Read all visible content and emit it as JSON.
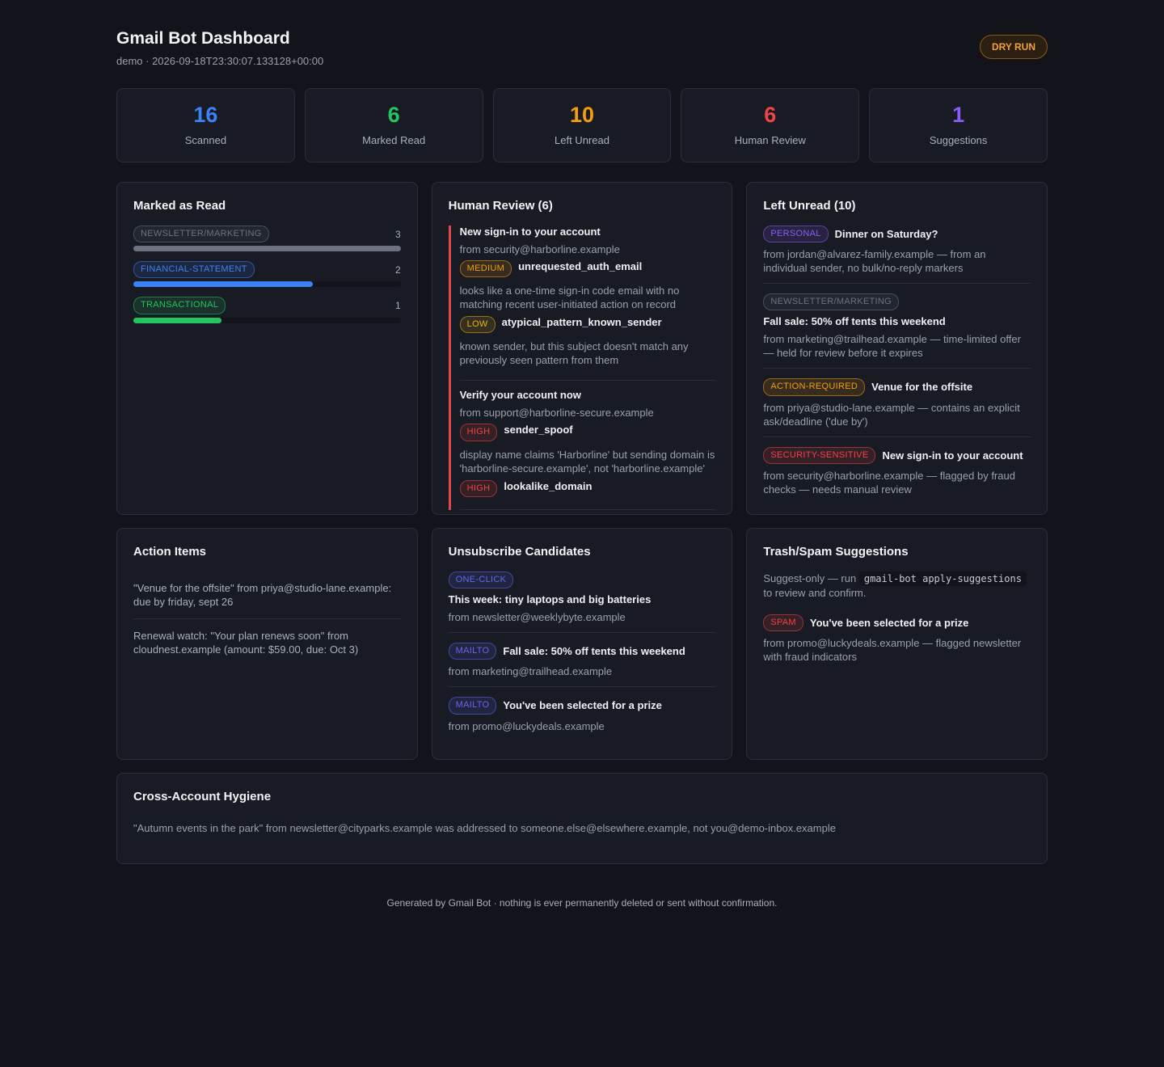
{
  "header": {
    "title": "Gmail Bot Dashboard",
    "subtitle": "demo · 2026-09-18T23:30:07.133128+00:00",
    "mode_badge": "DRY RUN"
  },
  "colors": {
    "blue": "#3b82f6",
    "green": "#22c55e",
    "amber": "#f59e0b",
    "red": "#ef4444",
    "purple": "#8b5cf6",
    "gray": "#6b7280"
  },
  "stats": [
    {
      "value": "16",
      "label": "Scanned",
      "color": "#3b82f6"
    },
    {
      "value": "6",
      "label": "Marked Read",
      "color": "#22c55e"
    },
    {
      "value": "10",
      "label": "Left Unread",
      "color": "#f59e0b"
    },
    {
      "value": "6",
      "label": "Human Review",
      "color": "#ef4444"
    },
    {
      "value": "1",
      "label": "Suggestions",
      "color": "#8b5cf6"
    }
  ],
  "marked_read": {
    "title": "Marked as Read",
    "items": [
      {
        "category": "NEWSLETTER/MARKETING",
        "count": "3",
        "fraction": 1.0
      },
      {
        "category": "FINANCIAL-STATEMENT",
        "count": "2",
        "fraction": 0.67
      },
      {
        "category": "TRANSACTIONAL",
        "count": "1",
        "fraction": 0.33
      }
    ]
  },
  "human_review": {
    "title": "Human Review (6)",
    "items": [
      {
        "subject": "New sign-in to your account",
        "from": "from security@harborline.example",
        "flags": [
          {
            "severity": "MEDIUM",
            "code": "unrequested_auth_email",
            "reason": "looks like a one-time sign-in code email with no matching recent user-initiated action on record"
          },
          {
            "severity": "LOW",
            "code": "atypical_pattern_known_sender",
            "reason": "known sender, but this subject doesn't match any previously seen pattern from them"
          }
        ]
      },
      {
        "subject": "Verify your account now",
        "from": "from support@harborline-secure.example",
        "flags": [
          {
            "severity": "HIGH",
            "code": "sender_spoof",
            "reason": "display name claims 'Harborline' but sending domain is 'harborline-secure.example', not 'harborline.example'"
          },
          {
            "severity": "HIGH",
            "code": "lookalike_domain",
            "reason": ""
          }
        ]
      }
    ]
  },
  "left_unread": {
    "title": "Left Unread (10)",
    "items": [
      {
        "tag": "PERSONAL",
        "subject": "Dinner on Saturday?",
        "detail": "from jordan@alvarez-family.example — from an individual sender, no bulk/no-reply markers"
      },
      {
        "tag": "NEWSLETTER/MARKETING",
        "subject": "Fall sale: 50% off tents this weekend",
        "detail": "from marketing@trailhead.example — time-limited offer — held for review before it expires"
      },
      {
        "tag": "ACTION-REQUIRED",
        "subject": "Venue for the offsite",
        "detail": "from priya@studio-lane.example — contains an explicit ask/deadline ('due by')"
      },
      {
        "tag": "SECURITY-SENSITIVE",
        "subject": "New sign-in to your account",
        "detail": "from security@harborline.example — flagged by fraud checks — needs manual review"
      }
    ]
  },
  "action_items": {
    "title": "Action Items",
    "items": [
      "\"Venue for the offsite\" from priya@studio-lane.example: due by friday, sept 26",
      "Renewal watch: \"Your plan renews soon\" from cloudnest.example (amount: $59.00, due: Oct 3)"
    ]
  },
  "unsubscribe": {
    "title": "Unsubscribe Candidates",
    "items": [
      {
        "method": "ONE-CLICK",
        "subject": "This week: tiny laptops and big batteries",
        "from": "from newsletter@weeklybyte.example"
      },
      {
        "method": "MAILTO",
        "subject": "Fall sale: 50% off tents this weekend",
        "from": "from marketing@trailhead.example"
      },
      {
        "method": "MAILTO",
        "subject": "You've been selected for a prize",
        "from": "from promo@luckydeals.example"
      }
    ]
  },
  "trash": {
    "title": "Trash/Spam Suggestions",
    "intro_prefix": "Suggest-only — run",
    "command": "gmail-bot apply-suggestions",
    "intro_suffix": "to review and confirm.",
    "items": [
      {
        "tag": "SPAM",
        "subject": "You've been selected for a prize",
        "detail": "from promo@luckydeals.example — flagged newsletter with fraud indicators"
      }
    ]
  },
  "hygiene": {
    "title": "Cross-Account Hygiene",
    "text": "\"Autumn events in the park\" from newsletter@cityparks.example was addressed to someone.else@elsewhere.example, not you@demo-inbox.example"
  },
  "footer": "Generated by Gmail Bot · nothing is ever permanently deleted or sent without confirmation."
}
